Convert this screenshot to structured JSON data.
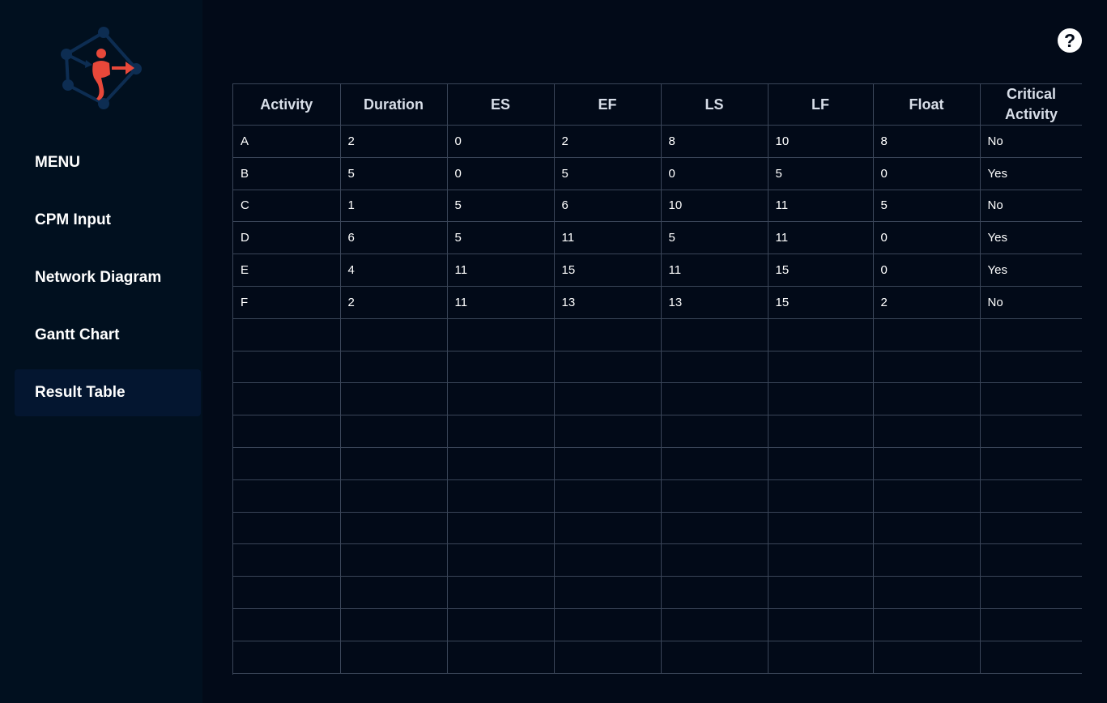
{
  "sidebar": {
    "logo": "cpm-network-logo",
    "menu_header": "MENU",
    "items": [
      {
        "label": "CPM Input",
        "active": false
      },
      {
        "label": "Network Diagram",
        "active": false
      },
      {
        "label": "Gantt Chart",
        "active": false
      },
      {
        "label": "Result Table",
        "active": true
      }
    ]
  },
  "header": {
    "help_icon": "?"
  },
  "table": {
    "columns": [
      "Activity",
      "Duration",
      "ES",
      "EF",
      "LS",
      "LF",
      "Float",
      "Critical Activity"
    ],
    "rows": [
      [
        "A",
        "2",
        "0",
        "2",
        "8",
        "10",
        "8",
        "No"
      ],
      [
        "B",
        "5",
        "0",
        "5",
        "0",
        "5",
        "0",
        "Yes"
      ],
      [
        "C",
        "1",
        "5",
        "6",
        "10",
        "11",
        "5",
        "No"
      ],
      [
        "D",
        "6",
        "5",
        "11",
        "5",
        "11",
        "0",
        "Yes"
      ],
      [
        "E",
        "4",
        "11",
        "15",
        "11",
        "15",
        "0",
        "Yes"
      ],
      [
        "F",
        "2",
        "11",
        "13",
        "13",
        "15",
        "2",
        "No"
      ]
    ],
    "empty_rows": 11
  },
  "colors": {
    "sidebar_bg": "#01101f",
    "main_bg": "#020a18",
    "active_item_bg": "#041630",
    "logo_accent": "#e8483a",
    "logo_network": "#0d2d52",
    "grid_line": "#3a4558"
  }
}
